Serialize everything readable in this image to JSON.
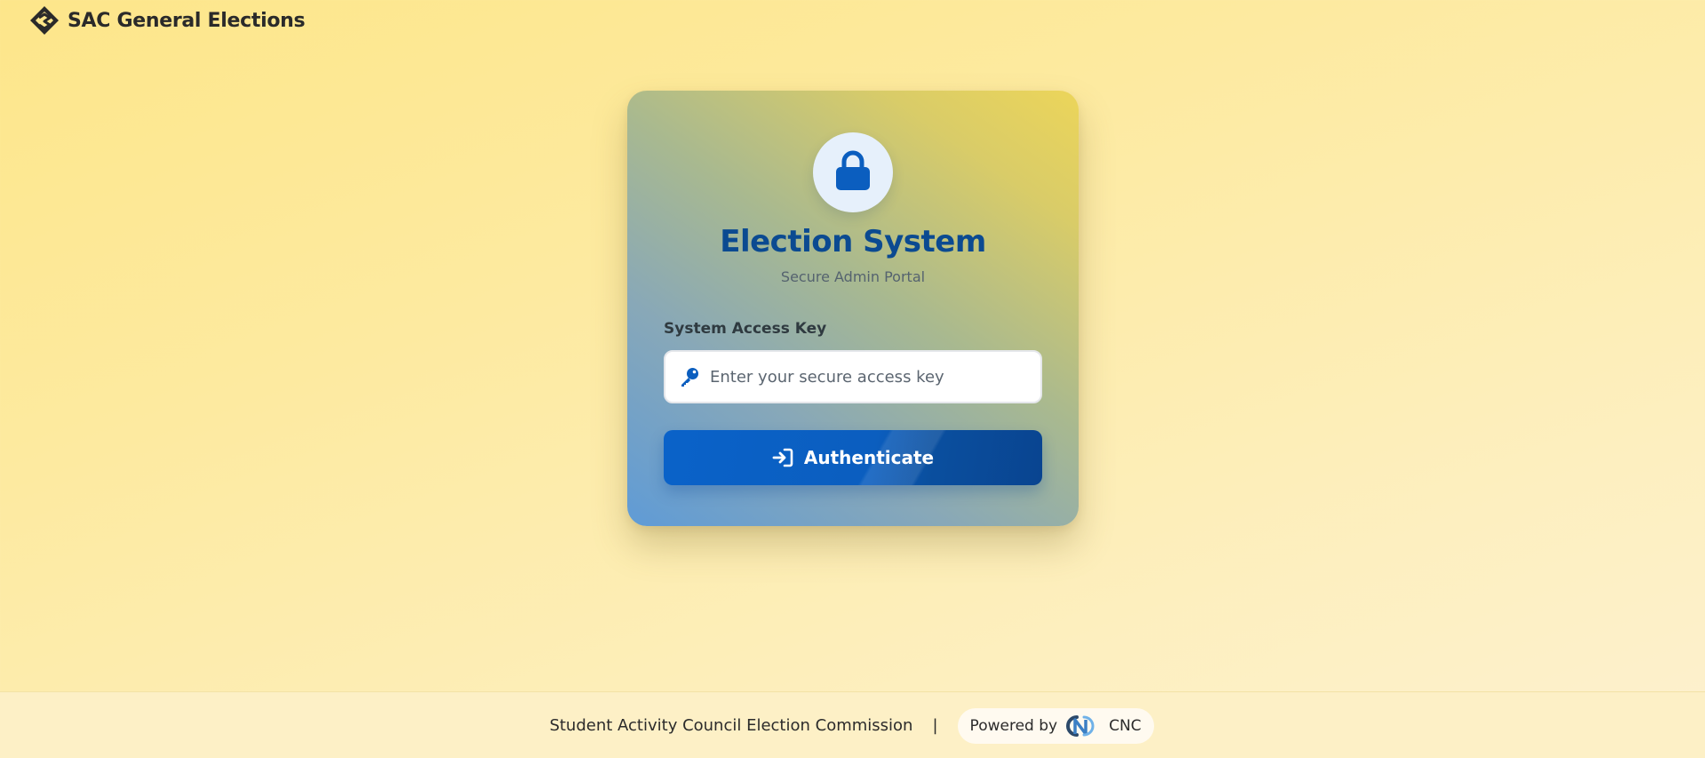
{
  "header": {
    "logo_icon": "sac-diamond-logo-icon",
    "title": "SAC General Elections"
  },
  "login": {
    "badge_icon": "lock-icon",
    "title": "Election System",
    "subtitle": "Secure Admin Portal",
    "field_label": "System Access Key",
    "input_icon": "key-icon",
    "input_value": "",
    "input_placeholder": "Enter your secure access key",
    "button_icon": "sign-in-icon",
    "button_label": "Authenticate"
  },
  "footer": {
    "organization": "Student Activity Council Election Commission",
    "separator": "|",
    "powered_by": "Powered by",
    "vendor_logo_icon": "cnc-logo-icon",
    "vendor_name": "CNC"
  },
  "colors": {
    "accent": "#0b5ebf",
    "title": "#0b4a91",
    "background": "#fde68a"
  }
}
